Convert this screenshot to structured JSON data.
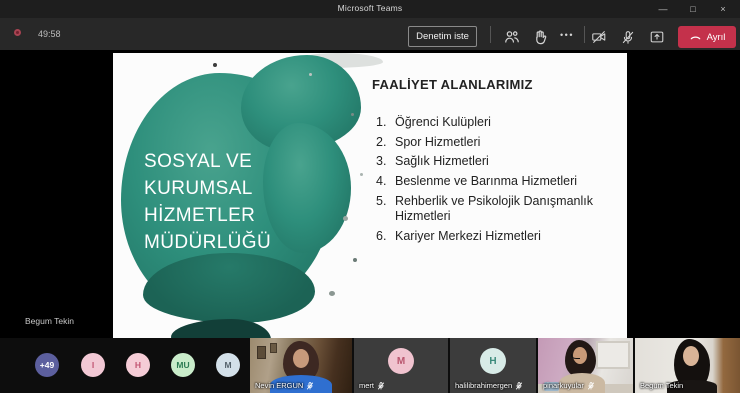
{
  "window": {
    "title": "Microsoft Teams",
    "controls": {
      "minimize": "—",
      "maximize": "□",
      "close": "×"
    }
  },
  "toolbar": {
    "timer": "49:58",
    "request_control_label": "Denetim iste",
    "more_glyph": "•••",
    "leave_label": "Ayrıl"
  },
  "stage": {
    "speaker_label": "Begum Tekin"
  },
  "slide": {
    "title_lines": [
      "SOSYAL VE",
      "KURUMSAL",
      "HİZMETLER",
      "MÜDÜRLÜĞÜ"
    ],
    "heading": "FAALİYET ALANLARIMIZ",
    "items": [
      {
        "num": "1.",
        "text": "Öğrenci Kulüpleri"
      },
      {
        "num": "2.",
        "text": "Spor Hizmetleri"
      },
      {
        "num": "3.",
        "text": "Sağlık Hizmetleri"
      },
      {
        "num": "4.",
        "text": "Beslenme ve Barınma Hizmetleri"
      },
      {
        "num": "5.",
        "text": "Rehberlik ve Psikolojik Danışmanlık Hizmetleri"
      },
      {
        "num": "6.",
        "text": "Kariyer Merkezi Hizmetleri"
      }
    ]
  },
  "participants": {
    "overflow_avatars": [
      {
        "initials": "+49",
        "style": "background:#5c5f9e;color:#ffffff"
      },
      {
        "initials": "I",
        "style": "background:#f2c8d4;color:#c25573"
      },
      {
        "initials": "H",
        "style": "background:#f5ccd6;color:#c25573"
      },
      {
        "initials": "MU",
        "style": "background:#c9ecca;color:#2e7d54"
      },
      {
        "initials": "M",
        "style": "background:#d3e0e9;color:#54616b"
      }
    ],
    "tiles": [
      {
        "name": "Nevin ERGUN",
        "type": "video",
        "muted": true
      },
      {
        "name": "mert",
        "type": "avatar",
        "initial": "M",
        "avatar_style": "background:#f0c3cf;color:#b9556e",
        "muted": true
      },
      {
        "name": "halilibrahimergen",
        "type": "avatar",
        "initial": "H",
        "avatar_style": "background:#d8ebe7;color:#3a8a7a",
        "muted": true
      },
      {
        "name": "pinarkuyular",
        "type": "video",
        "muted": true
      },
      {
        "name": "Begum Tekin",
        "type": "video",
        "muted": false
      }
    ]
  },
  "colors": {
    "accent-red": "#c4314b",
    "teal": "#2e8f7c",
    "titlebar": "#1e1e1e",
    "toolbar": "#282828",
    "tile-gray": "#3c3c3c"
  }
}
